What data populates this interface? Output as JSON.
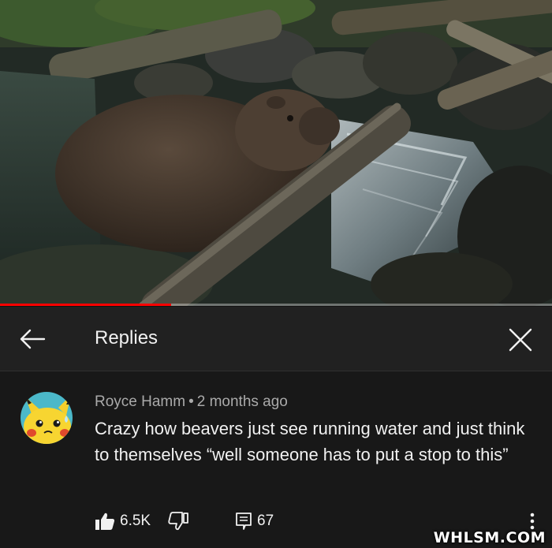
{
  "video": {
    "progress": 0.31,
    "progress_color": "#ff0000"
  },
  "header": {
    "back_icon": "arrow-left-icon",
    "title": "Replies",
    "close_icon": "close-icon"
  },
  "comment": {
    "author": "Royce Hamm",
    "separator": "•",
    "time": "2 months ago",
    "text": "Crazy how beavers just see running water and just think to themselves “well someone has to put a stop to this”",
    "avatar_icon": "pikachu-avatar",
    "likes": "6.5K",
    "like_icon": "thumbs-up-filled-icon",
    "dislike_icon": "thumbs-down-outline-icon",
    "reply_icon": "reply-comment-icon",
    "reply_count": "67",
    "more_icon": "more-vertical-icon"
  },
  "watermark": "WHLSM.COM",
  "colors": {
    "background": "#181818",
    "header_bg": "#212121",
    "text_primary": "#f1f1f1",
    "text_secondary": "#aaaaaa"
  }
}
